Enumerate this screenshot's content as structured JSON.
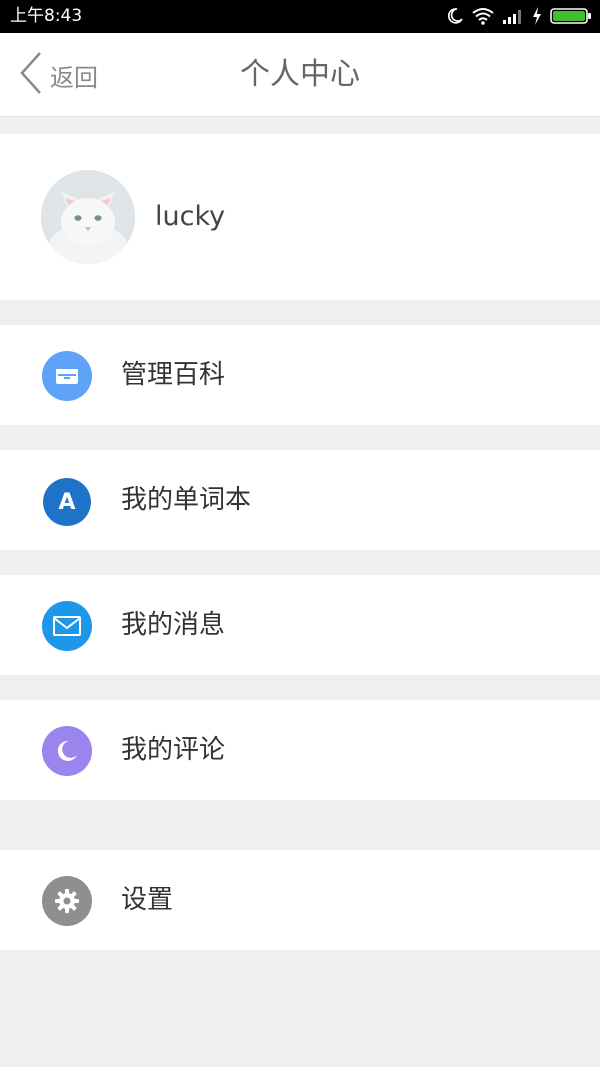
{
  "status_bar": {
    "time": "上午8:43",
    "icons": [
      "moon-icon",
      "wifi-icon",
      "signal-icon",
      "charging-icon",
      "battery-icon"
    ],
    "battery_color": "#3fbf2f"
  },
  "header": {
    "back_label": "返回",
    "title": "个人中心"
  },
  "profile": {
    "username": "lucky",
    "avatar": "cat-avatar"
  },
  "menu": [
    {
      "label": "管理百科",
      "icon": "box-icon",
      "color": "#5fa3f8"
    },
    {
      "label": "我的单词本",
      "icon": "letter-a-icon",
      "color": "#1e73c8",
      "icon_text": "A"
    },
    {
      "label": "我的消息",
      "icon": "mail-icon",
      "color": "#1e96ea"
    },
    {
      "label": "我的评论",
      "icon": "moon-icon",
      "color": "#9a84ee"
    },
    {
      "label": "设置",
      "icon": "gear-icon",
      "color": "#8f8f8f"
    }
  ]
}
